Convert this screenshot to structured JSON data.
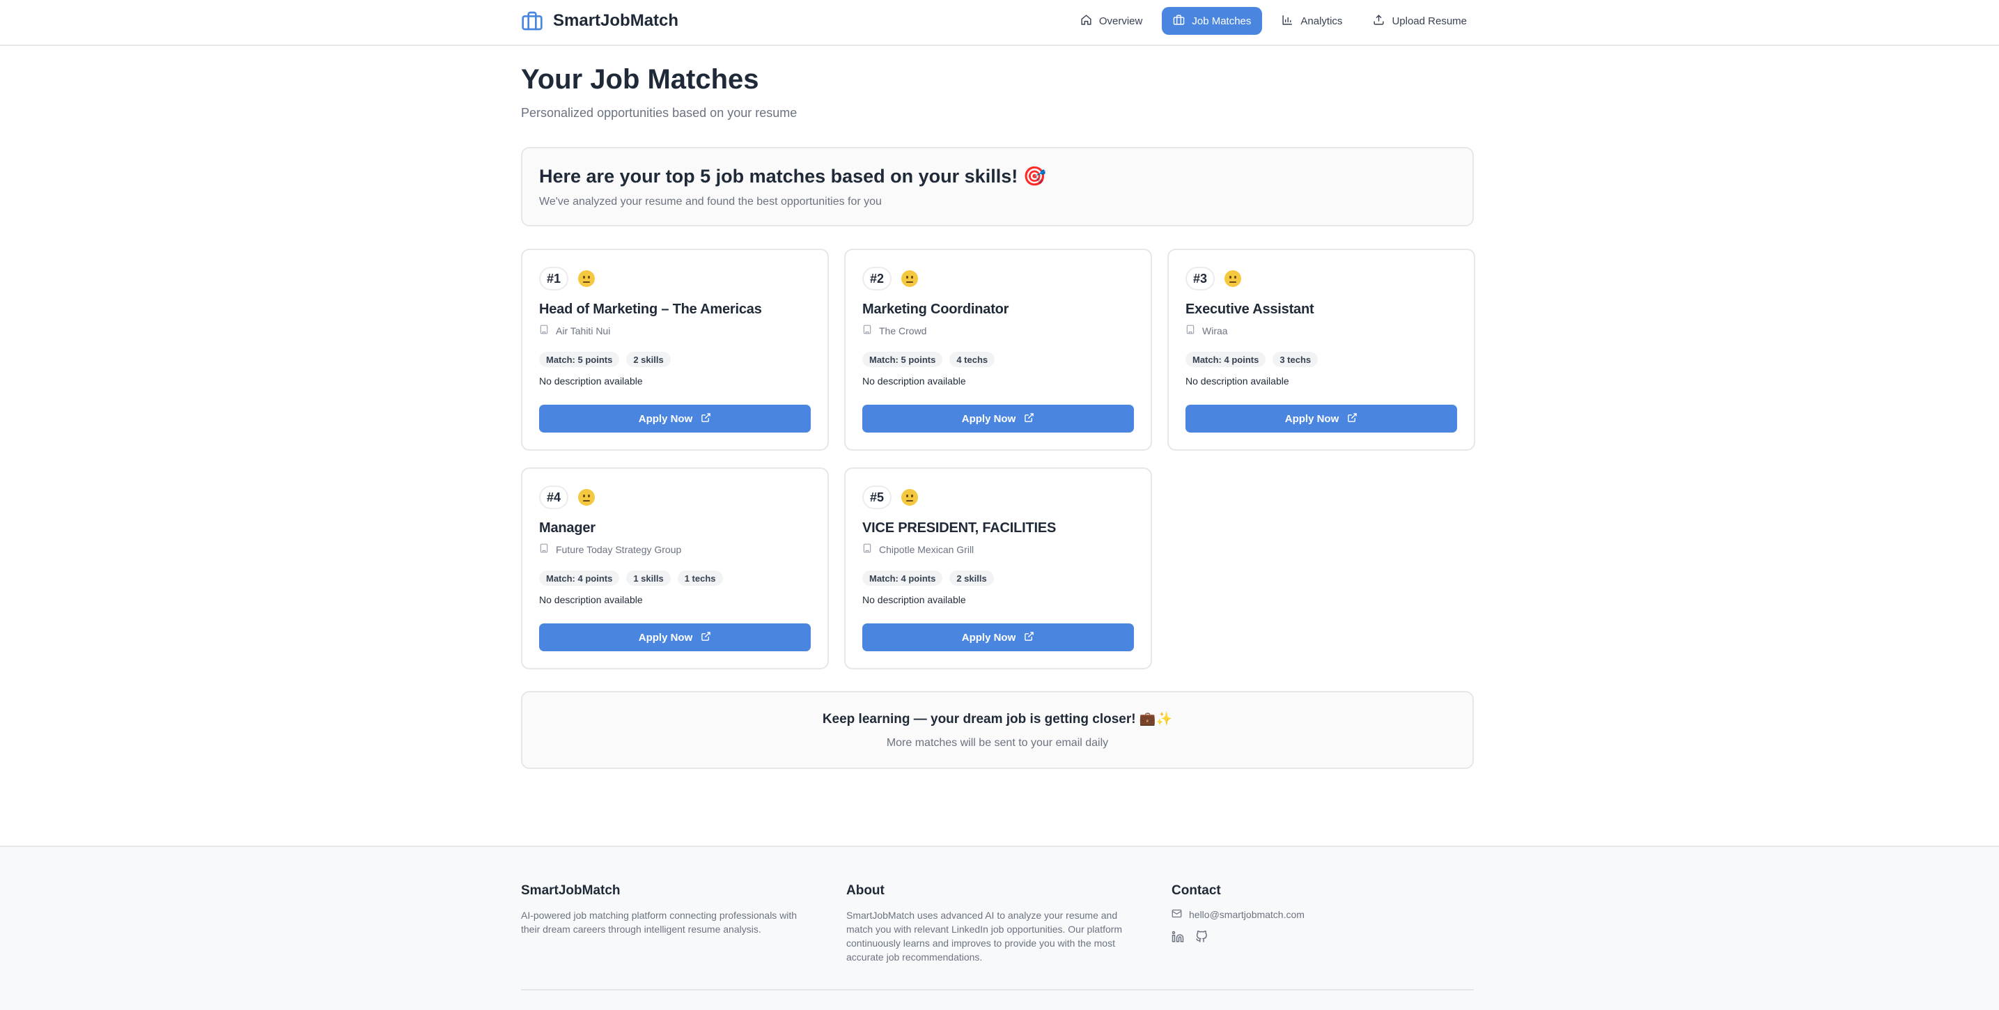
{
  "header": {
    "brand": "SmartJobMatch",
    "nav": [
      {
        "label": "Overview",
        "icon": "home-icon"
      },
      {
        "label": "Job Matches",
        "icon": "briefcase-icon",
        "active": true
      },
      {
        "label": "Analytics",
        "icon": "bar-chart-icon"
      },
      {
        "label": "Upload Resume",
        "icon": "upload-icon"
      }
    ]
  },
  "main": {
    "title": "Your Job Matches",
    "subtitle": "Personalized opportunities based on your resume",
    "intro": {
      "title": "Here are your top 5 job matches based on your skills! 🎯",
      "subtitle": "We've analyzed your resume and found the best opportunities for you"
    },
    "apply_label": "Apply Now",
    "jobs": [
      {
        "rank": "#1",
        "title": "Head of Marketing – The Americas",
        "company": "Air Tahiti Nui",
        "tags": [
          "Match: 5 points",
          "2 skills"
        ],
        "description": "No description available"
      },
      {
        "rank": "#2",
        "title": "Marketing Coordinator",
        "company": "The Crowd",
        "tags": [
          "Match: 5 points",
          "4 techs"
        ],
        "description": "No description available"
      },
      {
        "rank": "#3",
        "title": "Executive Assistant",
        "company": "Wiraa",
        "tags": [
          "Match: 4 points",
          "3 techs"
        ],
        "description": "No description available"
      },
      {
        "rank": "#4",
        "title": "Manager",
        "company": "Future Today Strategy Group",
        "tags": [
          "Match: 4 points",
          "1 skills",
          "1 techs"
        ],
        "description": "No description available"
      },
      {
        "rank": "#5",
        "title": "VICE PRESIDENT, FACILITIES",
        "company": "Chipotle Mexican Grill",
        "tags": [
          "Match: 4 points",
          "2 skills"
        ],
        "description": "No description available"
      }
    ],
    "cta": {
      "title": "Keep learning — your dream job is getting closer! 💼✨",
      "subtitle": "More matches will be sent to your email daily"
    }
  },
  "footer": {
    "brand": {
      "title": "SmartJobMatch",
      "text": "AI-powered job matching platform connecting professionals with their dream careers through intelligent resume analysis."
    },
    "about": {
      "title": "About",
      "text": "SmartJobMatch uses advanced AI to analyze your resume and match you with relevant LinkedIn job opportunities. Our platform continuously learns and improves to provide you with the most accurate job recommendations."
    },
    "contact": {
      "title": "Contact",
      "email": "hello@smartjobmatch.com",
      "social": [
        "linkedin-icon",
        "github-icon"
      ]
    }
  },
  "colors": {
    "accent": "#4a86e0",
    "text": "#1f2937",
    "muted": "#6b7280",
    "border": "#e5e7eb"
  }
}
